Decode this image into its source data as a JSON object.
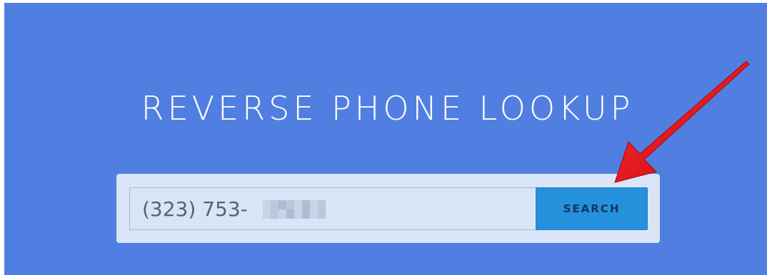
{
  "hero": {
    "title": "REVERSE PHONE LOOKUP"
  },
  "search": {
    "phone_value": "(323) 753-",
    "button_label": "SEARCH"
  },
  "colors": {
    "background": "#507fe1",
    "panel": "#dae4f7",
    "button": "#2591dd",
    "button_text": "#15325a",
    "arrow": "#e0121f"
  },
  "icons": {
    "annotation": "red-arrow-icon"
  }
}
